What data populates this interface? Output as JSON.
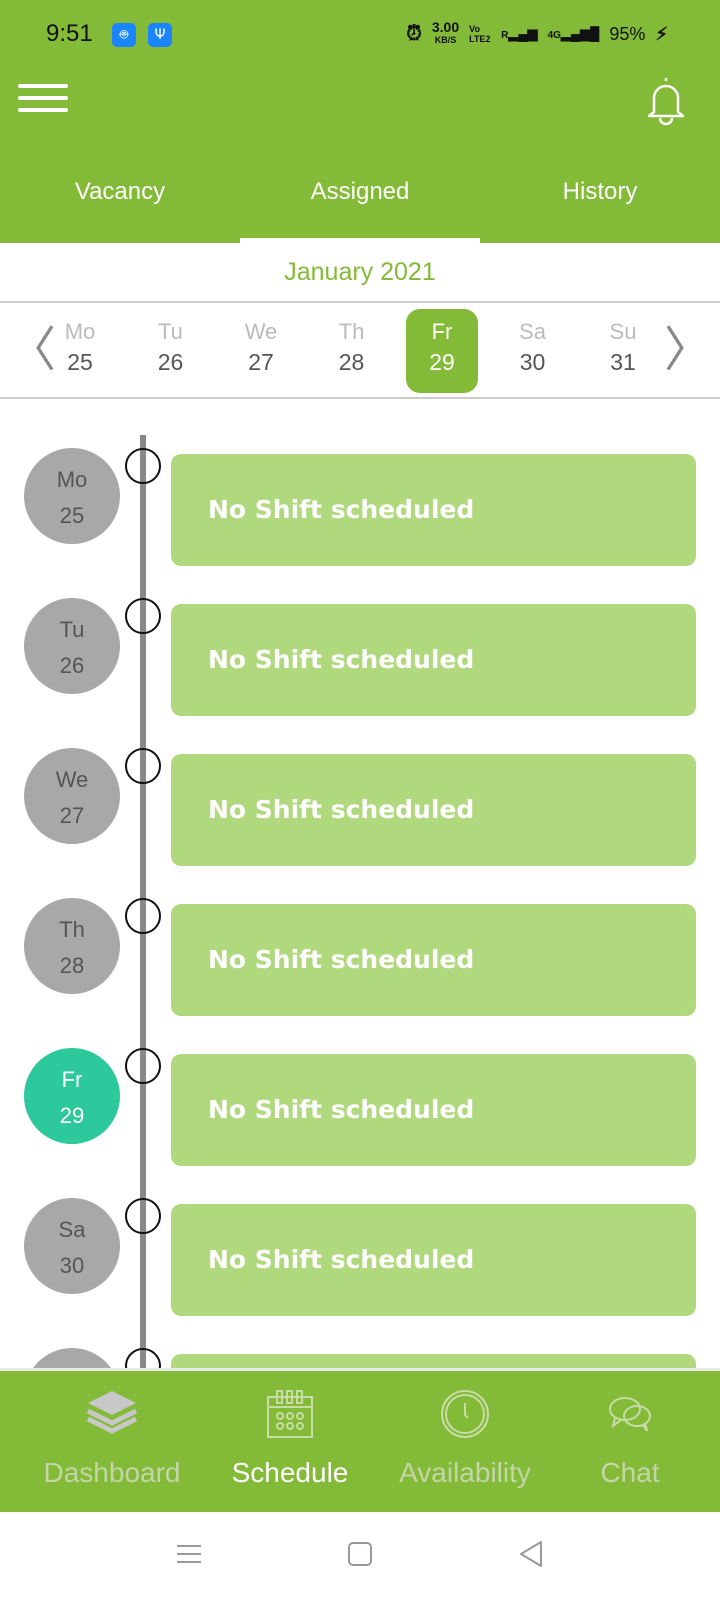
{
  "status_bar": {
    "time": "9:51",
    "net_speed": "3.00",
    "net_unit": "KB/S",
    "volte": "Vo LTE2",
    "roaming": "R",
    "network": "4G",
    "battery": "95%"
  },
  "header": {
    "tabs": [
      {
        "label": "Vacancy"
      },
      {
        "label": "Assigned",
        "active": true
      },
      {
        "label": "History"
      }
    ]
  },
  "month": "January 2021",
  "week": [
    {
      "name": "Mo",
      "day": "25"
    },
    {
      "name": "Tu",
      "day": "26"
    },
    {
      "name": "We",
      "day": "27"
    },
    {
      "name": "Th",
      "day": "28"
    },
    {
      "name": "Fr",
      "day": "29",
      "selected": true
    },
    {
      "name": "Sa",
      "day": "30"
    },
    {
      "name": "Su",
      "day": "31"
    }
  ],
  "schedule": [
    {
      "name": "Mo",
      "day": "25",
      "text": "No Shift scheduled"
    },
    {
      "name": "Tu",
      "day": "26",
      "text": "No Shift scheduled"
    },
    {
      "name": "We",
      "day": "27",
      "text": "No Shift scheduled"
    },
    {
      "name": "Th",
      "day": "28",
      "text": "No Shift scheduled"
    },
    {
      "name": "Fr",
      "day": "29",
      "text": "No Shift scheduled",
      "selected": true
    },
    {
      "name": "Sa",
      "day": "30",
      "text": "No Shift scheduled"
    }
  ],
  "bottom_nav": [
    {
      "label": "Dashboard",
      "icon": "layers-icon"
    },
    {
      "label": "Schedule",
      "icon": "calendar-icon",
      "active": true
    },
    {
      "label": "Availability",
      "icon": "clock-icon"
    },
    {
      "label": "Chat",
      "icon": "chat-icon"
    }
  ],
  "colors": {
    "primary": "#83ba37",
    "card": "#b0d97e",
    "today": "#2dc89b",
    "day_circle": "#a8a8a8"
  }
}
